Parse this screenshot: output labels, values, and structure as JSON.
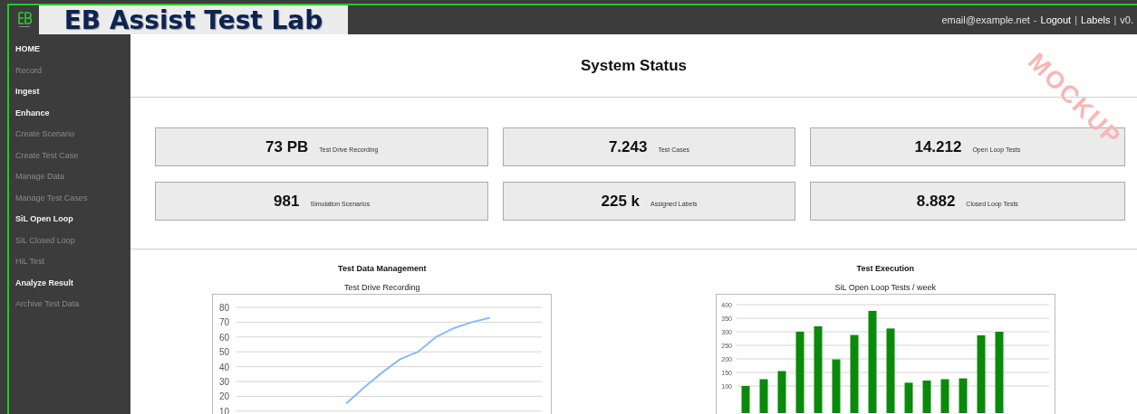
{
  "header": {
    "title": "EB Assist Test Lab",
    "user_links": [
      {
        "kind": "text",
        "text": "email@example.net"
      },
      {
        "kind": "sep",
        "text": "-"
      },
      {
        "kind": "link",
        "text": "Logout"
      },
      {
        "kind": "sep",
        "text": "|"
      },
      {
        "kind": "link",
        "text": "Labels"
      },
      {
        "kind": "sep",
        "text": "|"
      },
      {
        "kind": "text",
        "text": "v0."
      }
    ]
  },
  "sidebar": {
    "items": [
      {
        "label": "HOME",
        "disabled": false
      },
      {
        "label": "Record",
        "disabled": true
      },
      {
        "label": "Ingest",
        "disabled": false
      },
      {
        "label": "Enhance",
        "disabled": false
      },
      {
        "label": "Create Scenario",
        "disabled": true
      },
      {
        "label": "Create Test Case",
        "disabled": true
      },
      {
        "label": "Manage Data",
        "disabled": true
      },
      {
        "label": "Manage Test Cases",
        "disabled": true
      },
      {
        "label": "SiL Open Loop",
        "disabled": false
      },
      {
        "label": "SiL Closed Loop",
        "disabled": true
      },
      {
        "label": "HiL Test",
        "disabled": true
      },
      {
        "label": "Analyze Result",
        "disabled": false
      },
      {
        "label": "Archive Test Data",
        "disabled": true
      }
    ]
  },
  "page_title": "System Status",
  "stamp": "MOCKUP",
  "stats": [
    {
      "value": "73 PB",
      "label": "Test Drive Recording"
    },
    {
      "value": "7.243",
      "label": "Test Cases"
    },
    {
      "value": "14.212",
      "label": "Open Loop Tests"
    },
    {
      "value": "981",
      "label": "Simulation Scenarios"
    },
    {
      "value": "225 k",
      "label": "Assigned Labels"
    },
    {
      "value": "8.882",
      "label": "Closed Loop Tests"
    }
  ],
  "sections": [
    {
      "heading": "Test Data Management",
      "chart_data": {
        "type": "line",
        "title": "Test Drive Recording",
        "categories": [
          null,
          null,
          null,
          null,
          null,
          null,
          null,
          null,
          null,
          null,
          null,
          null,
          null,
          null,
          null,
          null,
          null
        ],
        "ylim": [
          10,
          80
        ],
        "yticks": [
          10,
          20,
          30,
          40,
          50,
          60,
          70,
          80
        ],
        "grid": true,
        "series": [
          {
            "color": "#88bbf5",
            "values": [
              null,
              null,
              null,
              null,
              null,
              null,
              15,
              26,
              36,
              45,
              50,
              60,
              66,
              70,
              73,
              null,
              null
            ]
          }
        ]
      }
    },
    {
      "heading": "Test Execution",
      "chart_data": {
        "type": "bar",
        "title": "SiL Open Loop Tests / week",
        "categories": [
          null,
          null,
          null,
          null,
          null,
          null,
          null,
          null,
          null,
          null,
          null,
          null,
          null,
          null,
          null
        ],
        "ylim": [
          0,
          400
        ],
        "yticks": [
          100,
          150,
          200,
          250,
          300,
          350,
          400
        ],
        "grid": true,
        "series": [
          {
            "color": "#0a8a0a",
            "values": [
              100,
              125,
              155,
              300,
              320,
              198,
              288,
              377,
              312,
              112,
              120,
              125,
              128,
              287,
              300
            ]
          }
        ]
      }
    }
  ]
}
